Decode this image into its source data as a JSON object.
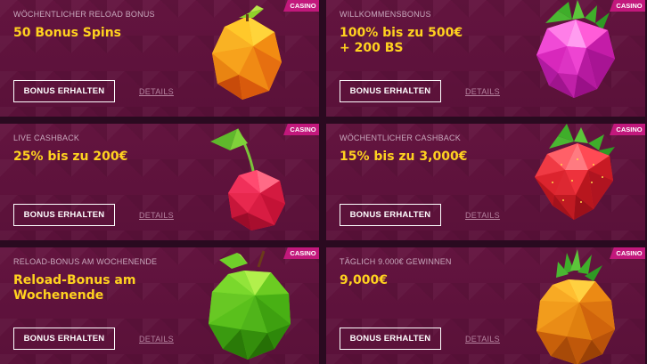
{
  "cards": [
    {
      "badge": "CASINO",
      "subtitle": "WÖCHENTLICHER RELOAD BONUS",
      "title": "50 Bonus Spins",
      "button": "BONUS ERHALTEN",
      "details": "DETAILS",
      "fruit_icon": "lemon-icon",
      "fruit_color": "#f5a21a"
    },
    {
      "badge": "CASINO",
      "subtitle": "WILLKOMMENSBONUS",
      "title": "100% bis zu 500€ + 200 BS",
      "button": "BONUS ERHALTEN",
      "details": "DETAILS",
      "fruit_icon": "raspberry-icon",
      "fruit_color": "#e432c8"
    },
    {
      "badge": "CASINO",
      "subtitle": "LIVE CASHBACK",
      "title": "25% bis zu 200€",
      "button": "BONUS ERHALTEN",
      "details": "DETAILS",
      "fruit_icon": "cherry-icon",
      "fruit_color": "#e8224a"
    },
    {
      "badge": "CASINO",
      "subtitle": "WÖCHENTLICHER CASHBACK",
      "title": "15% bis zu 3,000€",
      "button": "BONUS ERHALTEN",
      "details": "DETAILS",
      "fruit_icon": "strawberry-icon",
      "fruit_color": "#e62a34"
    },
    {
      "badge": "CASINO",
      "subtitle": "RELOAD-BONUS AM WOCHENENDE",
      "title": "Reload-Bonus am Wochenende",
      "button": "BONUS ERHALTEN",
      "details": "DETAILS",
      "fruit_icon": "apple-icon",
      "fruit_color": "#5bd41c"
    },
    {
      "badge": "CASINO",
      "subtitle": "TÄGLICH 9.000€ GEWINNEN",
      "title": "9,000€",
      "button": "BONUS ERHALTEN",
      "details": "DETAILS",
      "fruit_icon": "pineapple-icon",
      "fruit_color": "#f09a1c"
    }
  ],
  "colors": {
    "title": "#ffd21f",
    "badge": "#c2187c",
    "card_bg": "#5e1239"
  }
}
